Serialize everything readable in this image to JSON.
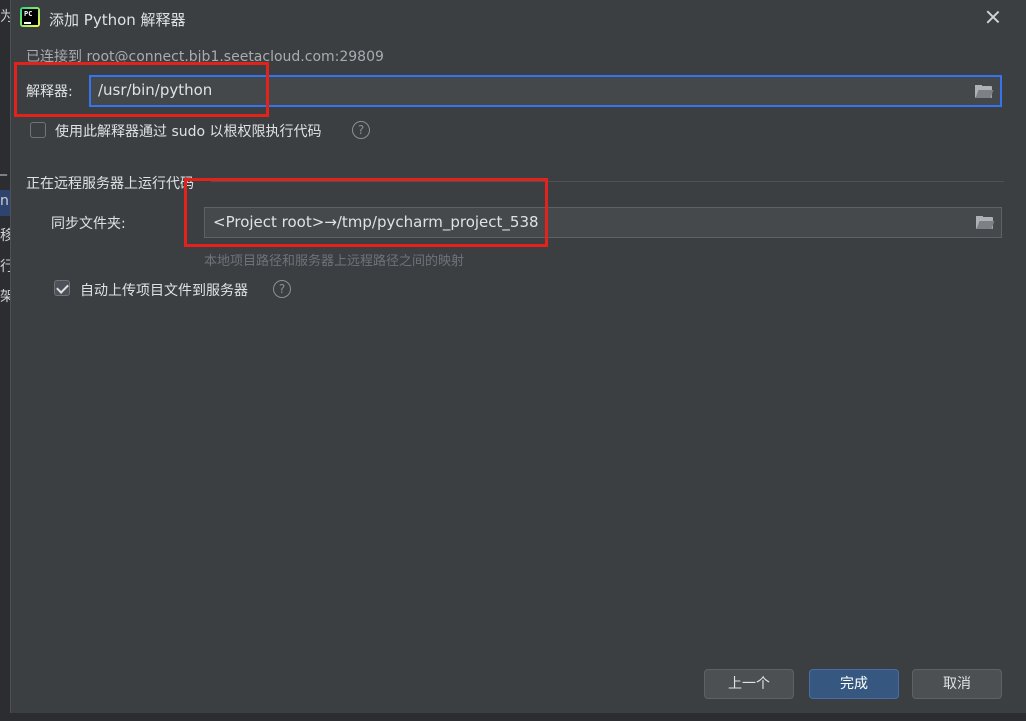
{
  "background": {
    "fragments": [
      "为",
      "_",
      "n",
      "移",
      "行",
      "架"
    ]
  },
  "dialog": {
    "title": "添加 Python 解释器",
    "connected_text": "已连接到 root@connect.bjb1.seetacloud.com:29809",
    "interpreter": {
      "label": "解释器:",
      "value": "/usr/bin/python"
    },
    "sudo": {
      "label": "使用此解释器通过 sudo 以根权限执行代码",
      "checked": false
    },
    "remote_section": {
      "title": "正在远程服务器上运行代码",
      "sync_label": "同步文件夹:",
      "sync_value": "<Project root>→/tmp/pycharm_project_538",
      "hint": "本地项目路径和服务器上远程路径之间的映射",
      "auto_upload": {
        "label": "自动上传项目文件到服务器",
        "checked": true
      }
    },
    "buttons": {
      "previous": "上一个",
      "finish": "完成",
      "cancel": "取消"
    },
    "help_glyph": "?"
  },
  "colors": {
    "accent": "#3574f0",
    "highlight": "#e3231b",
    "primary_button": "#365880",
    "dialog_bg": "#3c3f41"
  },
  "icons": [
    "pycharm-logo-icon",
    "close-icon",
    "folder-icon",
    "help-icon",
    "checkbox-icon"
  ]
}
